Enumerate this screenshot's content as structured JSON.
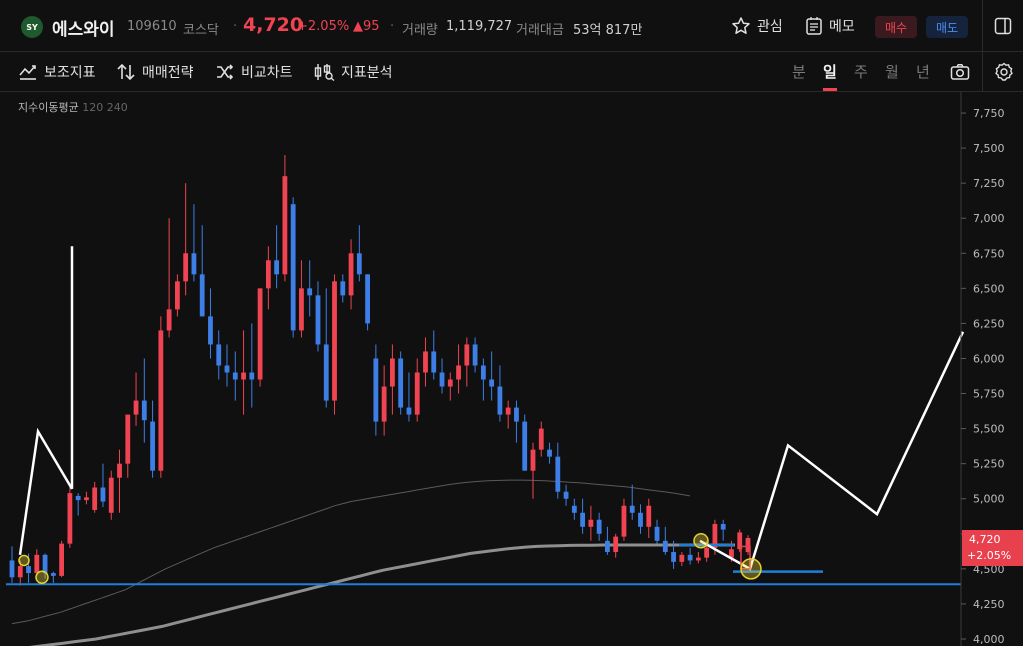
{
  "header": {
    "logo_text": "SY",
    "name": "에스와이",
    "code": "109610",
    "market": "코스닥",
    "separator": "·",
    "price": "4,720",
    "change_rate": "+2.05%",
    "change_amount": "▲95",
    "volume_label": "거래량",
    "volume_value": "1,119,727",
    "amount_label": "거래대금",
    "amount_value": "53억 817만",
    "favorite_label": "관심",
    "memo_label": "메모",
    "buy_label": "매수",
    "sell_label": "매도"
  },
  "toolbar": {
    "indicators_label": "보조지표",
    "strategy_label": "매매전략",
    "compare_label": "비교차트",
    "analysis_label": "지표분석",
    "periods": [
      "분",
      "일",
      "주",
      "월",
      "년"
    ],
    "active_period": "일"
  },
  "ma_legend": {
    "label": "지수이동평균",
    "p1": "120",
    "p2": "240"
  },
  "colors": {
    "up": "#f04452",
    "down": "#3d7fe6",
    "ma120": "#5a5a5a",
    "ma240": "#8f8f8f",
    "drawing": "#ffffff",
    "support": "#1f7fd8"
  },
  "chart_data": {
    "type": "candlestick",
    "y_ticks": [
      "7,750",
      "7,500",
      "7,250",
      "7,000",
      "6,750",
      "6,500",
      "6,250",
      "6,000",
      "5,750",
      "5,500",
      "5,250",
      "5,000",
      "4,750",
      "4,500",
      "4,250",
      "4,000"
    ],
    "ylim": [
      3950,
      7900
    ],
    "current_price_label": "4,720",
    "current_change_label": "+2.05%",
    "current_price_value": 4720,
    "candles": [
      [
        4560,
        4660,
        4400,
        4440
      ],
      [
        4440,
        4560,
        4380,
        4520
      ],
      [
        4520,
        4610,
        4400,
        4470
      ],
      [
        4470,
        4640,
        4450,
        4600
      ],
      [
        4600,
        4610,
        4430,
        4470
      ],
      [
        4470,
        4480,
        4400,
        4450
      ],
      [
        4450,
        4700,
        4440,
        4680
      ],
      [
        4680,
        5100,
        4650,
        5040
      ],
      [
        5020,
        5040,
        4880,
        4990
      ],
      [
        4990,
        5050,
        4960,
        5010
      ],
      [
        4920,
        5120,
        4900,
        5080
      ],
      [
        5080,
        5250,
        4940,
        4980
      ],
      [
        4900,
        5200,
        4850,
        5150
      ],
      [
        5150,
        5350,
        4900,
        5250
      ],
      [
        5250,
        5600,
        5150,
        5600
      ],
      [
        5600,
        5900,
        5520,
        5700
      ],
      [
        5700,
        6000,
        5400,
        5560
      ],
      [
        5550,
        5700,
        5150,
        5200
      ],
      [
        5200,
        6300,
        5150,
        6200
      ],
      [
        6200,
        7000,
        6150,
        6350
      ],
      [
        6350,
        6600,
        6300,
        6550
      ],
      [
        6550,
        7250,
        6450,
        6750
      ],
      [
        6750,
        7100,
        6550,
        6600
      ],
      [
        6600,
        6950,
        6400,
        6300
      ],
      [
        6300,
        6500,
        6000,
        6100
      ],
      [
        6100,
        6200,
        5850,
        5950
      ],
      [
        5950,
        6100,
        5800,
        5900
      ],
      [
        5900,
        6050,
        5700,
        5850
      ],
      [
        5850,
        6200,
        5600,
        5900
      ],
      [
        5900,
        6250,
        5650,
        5850
      ],
      [
        5850,
        6500,
        5800,
        6500
      ],
      [
        6500,
        6800,
        6350,
        6700
      ],
      [
        6700,
        6950,
        6500,
        6600
      ],
      [
        6600,
        7450,
        6550,
        7300
      ],
      [
        7100,
        7150,
        6150,
        6200
      ],
      [
        6200,
        6700,
        6150,
        6500
      ],
      [
        6500,
        6700,
        6300,
        6450
      ],
      [
        6450,
        6550,
        6050,
        6100
      ],
      [
        6100,
        6500,
        5650,
        5700
      ],
      [
        5700,
        6600,
        5600,
        6550
      ],
      [
        6550,
        6600,
        6400,
        6450
      ],
      [
        6450,
        6850,
        6350,
        6750
      ],
      [
        6750,
        6950,
        6550,
        6600
      ],
      [
        6600,
        6600,
        6200,
        6250
      ],
      [
        6000,
        6100,
        5450,
        5550
      ],
      [
        5550,
        5950,
        5450,
        5800
      ],
      [
        5800,
        6100,
        5600,
        6000
      ],
      [
        6000,
        6050,
        5600,
        5650
      ],
      [
        5650,
        5900,
        5550,
        5600
      ],
      [
        5600,
        6000,
        5550,
        5900
      ],
      [
        5900,
        6150,
        5800,
        6050
      ],
      [
        6050,
        6200,
        5850,
        5900
      ],
      [
        5900,
        6000,
        5750,
        5800
      ],
      [
        5800,
        5900,
        5700,
        5850
      ],
      [
        5850,
        6100,
        5750,
        5950
      ],
      [
        5950,
        6150,
        5800,
        6100
      ],
      [
        6100,
        6150,
        5900,
        5950
      ],
      [
        5950,
        6000,
        5700,
        5850
      ],
      [
        5850,
        6050,
        5700,
        5800
      ],
      [
        5800,
        5950,
        5550,
        5600
      ],
      [
        5600,
        5700,
        5500,
        5650
      ],
      [
        5650,
        5700,
        5400,
        5550
      ],
      [
        5550,
        5600,
        5200,
        5200
      ],
      [
        5200,
        5400,
        5000,
        5350
      ],
      [
        5350,
        5550,
        5300,
        5500
      ],
      [
        5350,
        5400,
        5250,
        5300
      ],
      [
        5300,
        5400,
        5000,
        5050
      ],
      [
        5050,
        5100,
        4950,
        5000
      ],
      [
        4950,
        5000,
        4850,
        4900
      ],
      [
        4900,
        5000,
        4750,
        4800
      ],
      [
        4800,
        4950,
        4700,
        4850
      ],
      [
        4850,
        4900,
        4700,
        4750
      ],
      [
        4700,
        4800,
        4600,
        4620
      ],
      [
        4620,
        4750,
        4580,
        4730
      ],
      [
        4730,
        5000,
        4700,
        4950
      ],
      [
        4950,
        5100,
        4850,
        4900
      ],
      [
        4900,
        4960,
        4750,
        4800
      ],
      [
        4800,
        5000,
        4720,
        4950
      ],
      [
        4800,
        4850,
        4680,
        4700
      ],
      [
        4700,
        4800,
        4600,
        4620
      ],
      [
        4620,
        4700,
        4500,
        4550
      ],
      [
        4550,
        4620,
        4520,
        4600
      ],
      [
        4600,
        4650,
        4530,
        4560
      ],
      [
        4560,
        4620,
        4540,
        4580
      ],
      [
        4580,
        4700,
        4550,
        4650
      ],
      [
        4650,
        4850,
        4600,
        4820
      ],
      [
        4820,
        4850,
        4700,
        4780
      ],
      [
        4580,
        4700,
        4550,
        4640
      ],
      [
        4640,
        4780,
        4620,
        4760
      ],
      [
        4620,
        4740,
        4600,
        4720
      ]
    ],
    "ma120": [
      4110,
      4120,
      4130,
      4145,
      4160,
      4175,
      4190,
      4210,
      4230,
      4250,
      4270,
      4290,
      4310,
      4330,
      4350,
      4380,
      4410,
      4440,
      4470,
      4500,
      4525,
      4550,
      4575,
      4600,
      4625,
      4650,
      4670,
      4690,
      4710,
      4730,
      4750,
      4770,
      4790,
      4810,
      4830,
      4850,
      4870,
      4890,
      4910,
      4930,
      4950,
      4965,
      4980,
      4990,
      5000,
      5010,
      5020,
      5030,
      5040,
      5050,
      5060,
      5070,
      5080,
      5090,
      5100,
      5108,
      5115,
      5120,
      5125,
      5128,
      5130,
      5132,
      5133,
      5133,
      5132,
      5130,
      5128,
      5125,
      5122,
      5118,
      5115,
      5110,
      5105,
      5100,
      5095,
      5090,
      5085,
      5078,
      5070,
      5062,
      5055,
      5048,
      5040,
      5030,
      5020
    ],
    "ma240": [
      3920,
      3930,
      3940,
      3950,
      3960,
      3970,
      3980,
      3990,
      4000,
      4015,
      4030,
      4045,
      4060,
      4075,
      4090,
      4110,
      4130,
      4150,
      4170,
      4190,
      4210,
      4230,
      4250,
      4270,
      4290,
      4310,
      4330,
      4350,
      4370,
      4390,
      4410,
      4430,
      4450,
      4470,
      4490,
      4505,
      4520,
      4535,
      4550,
      4565,
      4580,
      4595,
      4610,
      4620,
      4630,
      4640,
      4648,
      4655,
      4660,
      4663,
      4665,
      4667,
      4668,
      4669,
      4670,
      4670,
      4670,
      4670,
      4670,
      4670,
      4670,
      4670,
      4670,
      4670,
      4670,
      4670,
      4670
    ],
    "support_level": 4390
  }
}
